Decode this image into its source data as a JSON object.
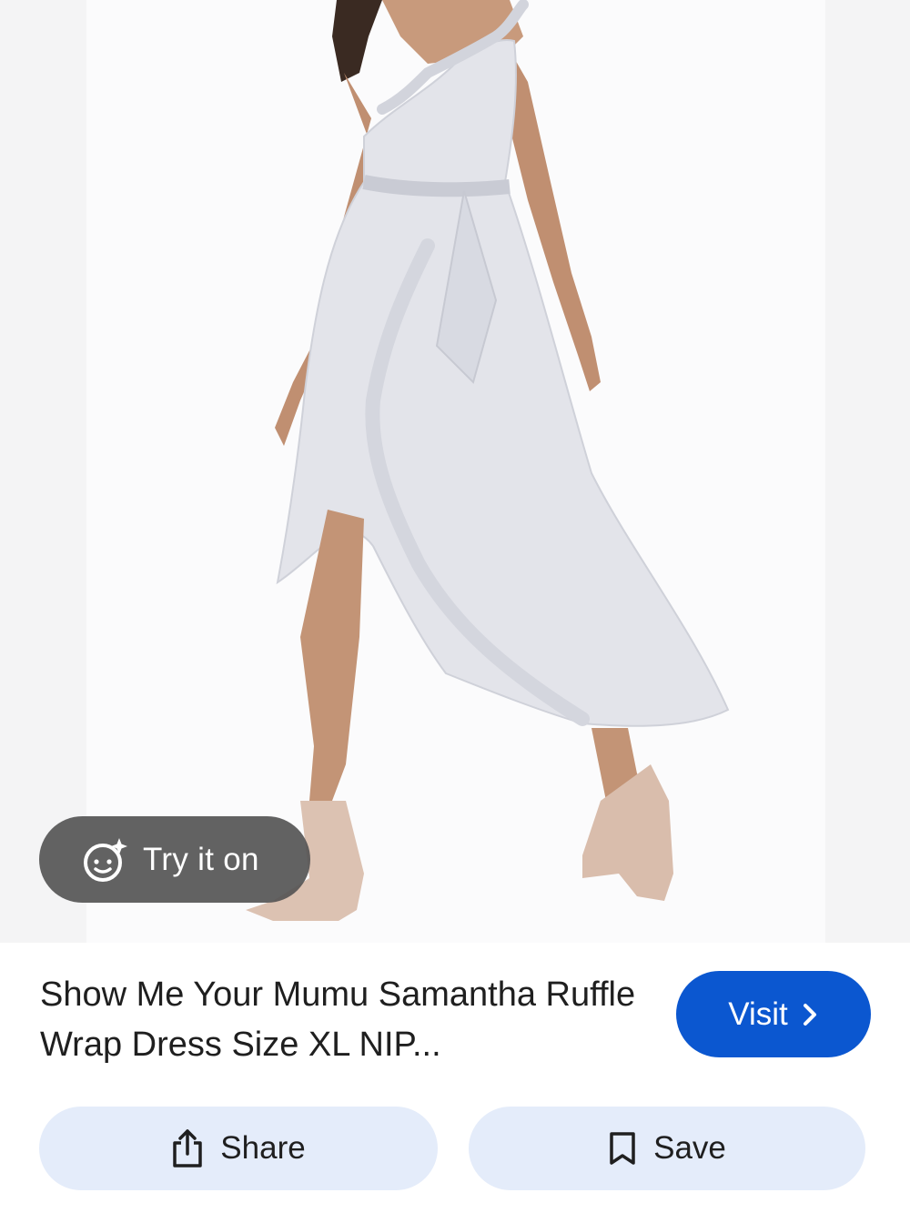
{
  "image": {
    "alt_subject": "model-wearing-silver-ruffle-wrap-dress",
    "icon_try_on": "face-sparkle-icon"
  },
  "try_on": {
    "label": "Try it on"
  },
  "product": {
    "title": "Show Me Your Mumu Samantha Ruffle Wrap Dress Size XL NIP..."
  },
  "visit": {
    "label": "Visit",
    "icon": "chevron-right-icon"
  },
  "actions": {
    "share_label": "Share",
    "share_icon": "share-icon",
    "save_label": "Save",
    "save_icon": "bookmark-icon"
  },
  "colors": {
    "visit_bg": "#0b57d0",
    "pill_bg": "#e4ecfa",
    "tryon_bg": "#555555",
    "dress": "#e3e4ea"
  }
}
